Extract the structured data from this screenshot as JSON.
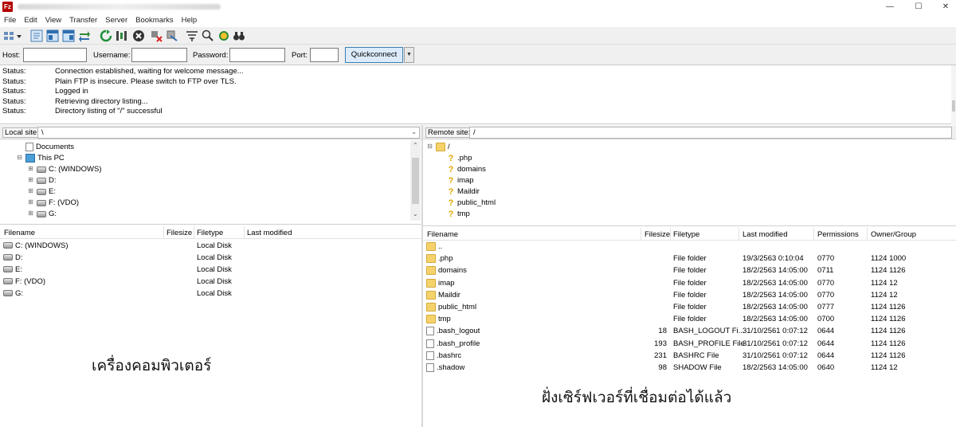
{
  "window": {
    "minimize_glyph": "—",
    "maximize_glyph": "☐",
    "close_glyph": "✕"
  },
  "menu": [
    "File",
    "Edit",
    "View",
    "Transfer",
    "Server",
    "Bookmarks",
    "Help"
  ],
  "toolbar": {
    "icons": [
      "site-manager-icon",
      "toggle-log-icon",
      "toggle-local-tree-icon",
      "toggle-remote-tree-icon",
      "toggle-queue-icon",
      "refresh-icon",
      "process-queue-icon",
      "cancel-icon",
      "disconnect-icon",
      "reconnect-icon",
      "filter-icon",
      "compare-icon",
      "sync-browse-icon",
      "search-icon"
    ]
  },
  "quickconnect": {
    "host_label": "Host:",
    "host_value": "",
    "username_label": "Username:",
    "username_value": "",
    "password_label": "Password:",
    "password_value": "",
    "port_label": "Port:",
    "port_value": "",
    "button_label": "Quickconnect",
    "dropdown_glyph": "▼"
  },
  "log": [
    {
      "type": "Status:",
      "message": "Connection established, waiting for welcome message..."
    },
    {
      "type": "Status:",
      "message": "Plain FTP is insecure. Please switch to FTP over TLS."
    },
    {
      "type": "Status:",
      "message": "Logged in"
    },
    {
      "type": "Status:",
      "message": "Retrieving directory listing..."
    },
    {
      "type": "Status:",
      "message": "Directory listing of \"/\" successful"
    }
  ],
  "local": {
    "site_label": "Local site:",
    "path": "\\",
    "tree": [
      {
        "label": "Documents",
        "icon": "document-icon"
      },
      {
        "label": "This PC",
        "icon": "computer-icon"
      },
      {
        "label": "C: (WINDOWS)",
        "icon": "drive-icon"
      },
      {
        "label": "D:",
        "icon": "drive-icon"
      },
      {
        "label": "E:",
        "icon": "drive-icon"
      },
      {
        "label": "F: (VDO)",
        "icon": "drive-icon"
      },
      {
        "label": "G:",
        "icon": "drive-icon"
      }
    ],
    "columns": [
      "Filename",
      "Filesize",
      "Filetype",
      "Last modified"
    ],
    "files": [
      {
        "name": "C: (WINDOWS)",
        "size": "",
        "type": "Local Disk",
        "modified": ""
      },
      {
        "name": "D:",
        "size": "",
        "type": "Local Disk",
        "modified": ""
      },
      {
        "name": "E:",
        "size": "",
        "type": "Local Disk",
        "modified": ""
      },
      {
        "name": "F: (VDO)",
        "size": "",
        "type": "Local Disk",
        "modified": ""
      },
      {
        "name": "G:",
        "size": "",
        "type": "Local Disk",
        "modified": ""
      }
    ],
    "caption": "เครื่องคอมพิวเตอร์"
  },
  "remote": {
    "site_label": "Remote site:",
    "path": "/",
    "tree_root": "/",
    "tree": [
      ".php",
      "domains",
      "imap",
      "Maildir",
      "public_html",
      "tmp"
    ],
    "columns": [
      "Filename",
      "Filesize",
      "Filetype",
      "Last modified",
      "Permissions",
      "Owner/Group"
    ],
    "files": [
      {
        "name": "..",
        "size": "",
        "type": "",
        "modified": "",
        "perm": "",
        "owner": "",
        "kind": "folder"
      },
      {
        "name": ".php",
        "size": "",
        "type": "File folder",
        "modified": "19/3/2563 0:10:04",
        "perm": "0770",
        "owner": "1124 1000",
        "kind": "folder"
      },
      {
        "name": "domains",
        "size": "",
        "type": "File folder",
        "modified": "18/2/2563 14:05:00",
        "perm": "0711",
        "owner": "1124 1126",
        "kind": "folder"
      },
      {
        "name": "imap",
        "size": "",
        "type": "File folder",
        "modified": "18/2/2563 14:05:00",
        "perm": "0770",
        "owner": "1124 12",
        "kind": "folder"
      },
      {
        "name": "Maildir",
        "size": "",
        "type": "File folder",
        "modified": "18/2/2563 14:05:00",
        "perm": "0770",
        "owner": "1124 12",
        "kind": "folder"
      },
      {
        "name": "public_html",
        "size": "",
        "type": "File folder",
        "modified": "18/2/2563 14:05:00",
        "perm": "0777",
        "owner": "1124 1126",
        "kind": "link"
      },
      {
        "name": "tmp",
        "size": "",
        "type": "File folder",
        "modified": "18/2/2563 14:05:00",
        "perm": "0700",
        "owner": "1124 1126",
        "kind": "folder"
      },
      {
        "name": ".bash_logout",
        "size": "18",
        "type": "BASH_LOGOUT Fi...",
        "modified": "31/10/2561 0:07:12",
        "perm": "0644",
        "owner": "1124 1126",
        "kind": "file"
      },
      {
        "name": ".bash_profile",
        "size": "193",
        "type": "BASH_PROFILE File",
        "modified": "31/10/2561 0:07:12",
        "perm": "0644",
        "owner": "1124 1126",
        "kind": "file"
      },
      {
        "name": ".bashrc",
        "size": "231",
        "type": "BASHRC File",
        "modified": "31/10/2561 0:07:12",
        "perm": "0644",
        "owner": "1124 1126",
        "kind": "file"
      },
      {
        "name": ".shadow",
        "size": "98",
        "type": "SHADOW File",
        "modified": "18/2/2563 14:05:00",
        "perm": "0640",
        "owner": "1124 12",
        "kind": "file"
      }
    ],
    "caption": "ฝั่งเซิร์ฟเวอร์ที่เชื่อมต่อได้แล้ว"
  }
}
